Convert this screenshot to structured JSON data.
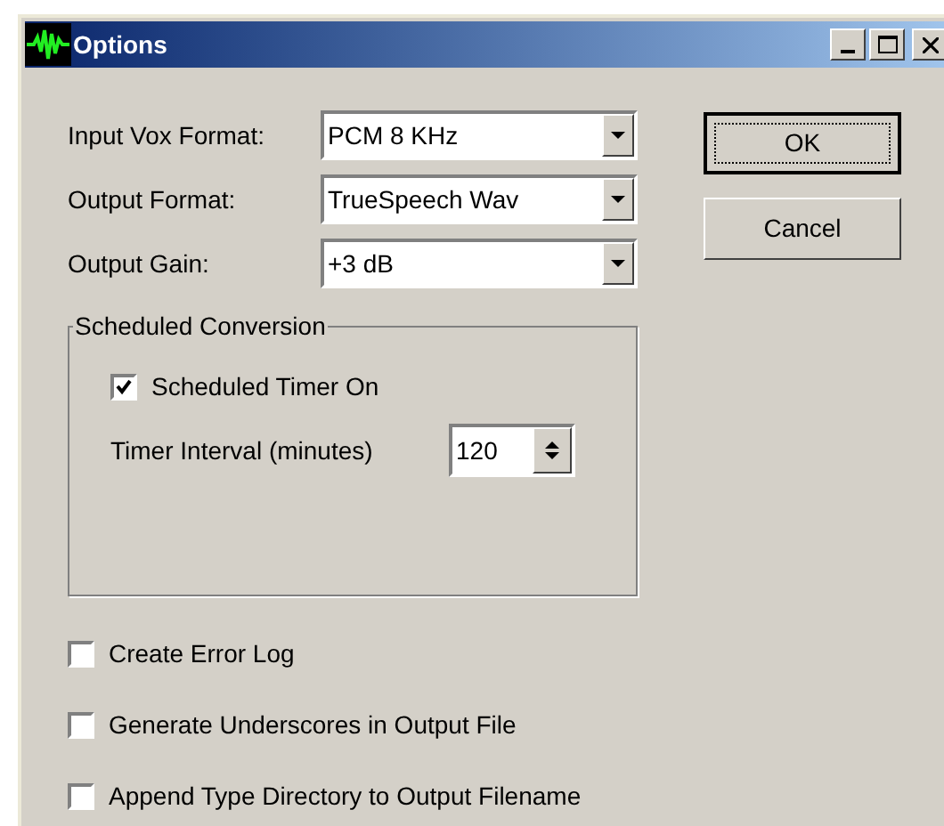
{
  "window": {
    "title": "Options"
  },
  "fields": [
    {
      "label": "Input Vox Format:",
      "value": "PCM 8 KHz"
    },
    {
      "label": "Output Format:",
      "value": "TrueSpeech Wav"
    },
    {
      "label": "Output Gain:",
      "value": "+3 dB"
    }
  ],
  "buttons": [
    {
      "label": "OK",
      "default": true
    },
    {
      "label": "Cancel",
      "default": false
    }
  ],
  "group": {
    "title": "Scheduled Conversion",
    "timer_on": {
      "label": "Scheduled Timer On",
      "checked": true
    },
    "interval": {
      "label": "Timer Interval (minutes)",
      "value": "120"
    }
  },
  "options": [
    {
      "label": "Create Error Log",
      "checked": false
    },
    {
      "label": "Generate Underscores in Output File",
      "checked": false
    },
    {
      "label": "Append Type Directory to Output Filename",
      "checked": false
    }
  ]
}
